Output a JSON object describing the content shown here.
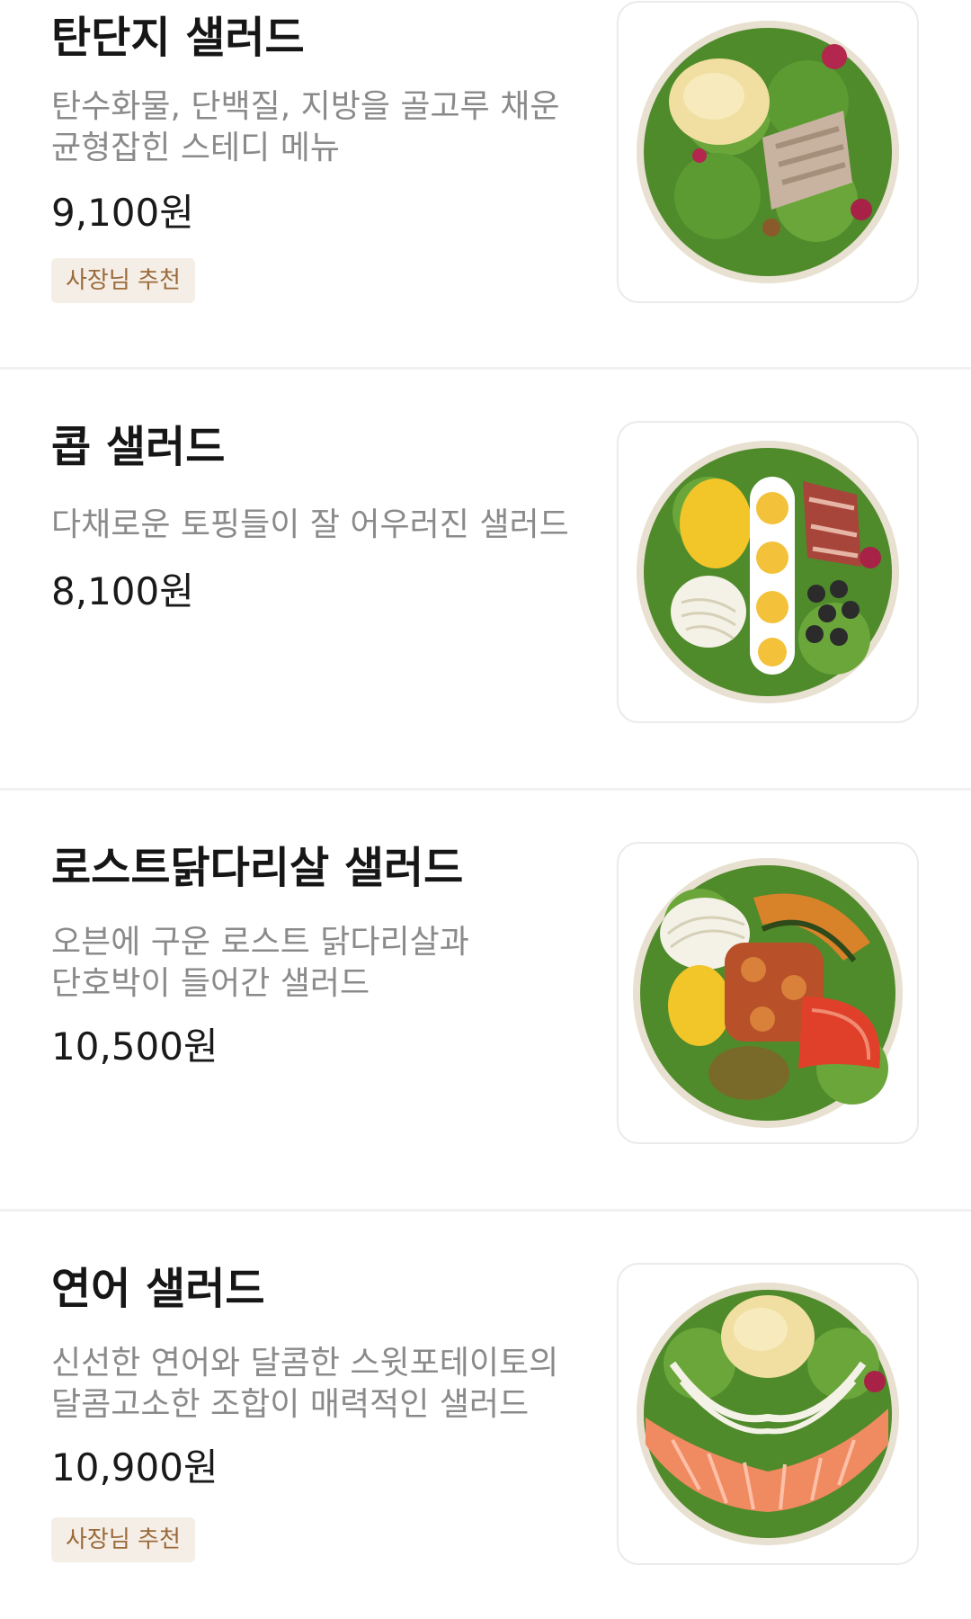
{
  "menu": {
    "items": [
      {
        "name": "탄단지 샐러드",
        "desc_lines": [
          "탄수화물, 단백질, 지방을 골고루 채운",
          "균형잡힌 스테디 메뉴"
        ],
        "price": "9,100원",
        "badge": "사장님 추천",
        "photo": "tandanji-salad-photo"
      },
      {
        "name": "콥 샐러드",
        "desc_lines": [
          "다채로운 토핑들이 잘 어우러진 샐러드"
        ],
        "price": "8,100원",
        "badge": null,
        "photo": "cobb-salad-photo"
      },
      {
        "name": "로스트닭다리살 샐러드",
        "desc_lines": [
          "오븐에 구운 로스트 닭다리살과",
          "단호박이 들어간 샐러드"
        ],
        "price": "10,500원",
        "badge": null,
        "photo": "roast-chicken-thigh-salad-photo"
      },
      {
        "name": "연어 샐러드",
        "desc_lines": [
          "신선한 연어와 달콤한 스윗포테이토의",
          "달콤고소한 조합이 매력적인 샐러드"
        ],
        "price": "10,900원",
        "badge": "사장님 추천",
        "photo": "salmon-salad-photo"
      }
    ]
  },
  "colors": {
    "badge_bg": "#f5eee6",
    "badge_text": "#9a6a3a",
    "description": "#8a8a8a",
    "lettuce": "#4f8a2b",
    "bowl_rim": "#e8e0d0"
  }
}
